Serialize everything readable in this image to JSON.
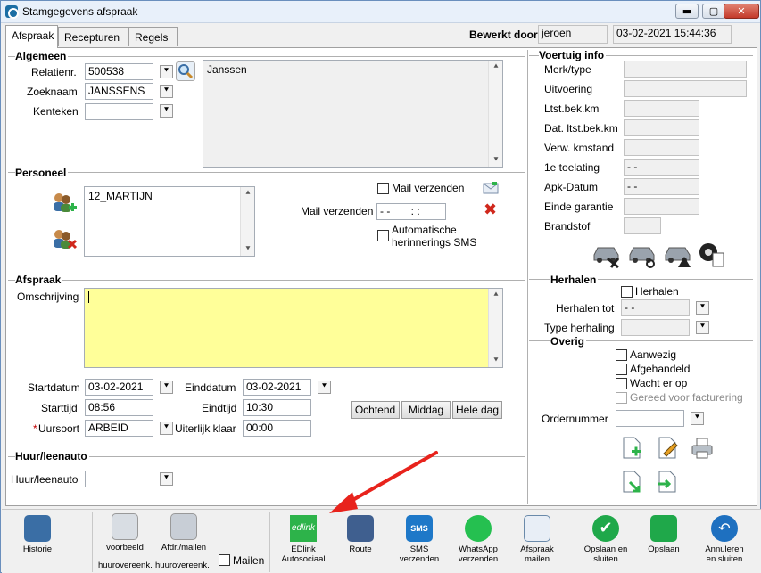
{
  "window": {
    "title": "Stamgegevens afspraak",
    "minimize": "▬",
    "maximize": "▢",
    "close": "✕"
  },
  "tabs": [
    "Afspraak",
    "Recepturen",
    "Regels"
  ],
  "header": {
    "edited_by_label": "Bewerkt door",
    "edited_by": "jeroen",
    "edited_at": "03-02-2021 15:44:36"
  },
  "algemeen": {
    "section": "Algemeen",
    "relatienr_label": "Relatienr.",
    "relatienr": "500538",
    "zoeknaam_label": "Zoeknaam",
    "zoeknaam": "JANSSENS",
    "kenteken_label": "Kenteken",
    "kenteken": "",
    "memo": "Janssen"
  },
  "personeel": {
    "section": "Personeel",
    "employee": "12_MARTIJN",
    "mail_verzenden_check": "Mail verzenden",
    "mail_verzenden_label": "Mail verzenden",
    "mail_datetime": "- -       : :",
    "auto_sms": "Automatische herinnerings SMS"
  },
  "afspraak": {
    "section": "Afspraak",
    "omschrijving_label": "Omschrijving",
    "startdatum_label": "Startdatum",
    "startdatum": "03-02-2021",
    "einddatum_label": "Einddatum",
    "einddatum": "03-02-2021",
    "starttijd_label": "Starttijd",
    "starttijd": "08:56",
    "eindtijd_label": "Eindtijd",
    "eindtijd": "10:30",
    "uursoort_label": "Uursoort",
    "uursoort_required": "*",
    "uursoort": "ARBEID",
    "uiterlijk_label": "Uiterlijk klaar",
    "uiterlijk": "00:00",
    "ochtend": "Ochtend",
    "middag": "Middag",
    "heledag": "Hele dag"
  },
  "huur": {
    "section": "Huur/leenauto",
    "label": "Huur/leenauto",
    "value": ""
  },
  "voertuig": {
    "section": "Voertuig info",
    "fields": [
      {
        "label": "Merk/type",
        "value": ""
      },
      {
        "label": "Uitvoering",
        "value": ""
      },
      {
        "label": "Ltst.bek.km",
        "value": ""
      },
      {
        "label": "Dat. ltst.bek.km",
        "value": ""
      },
      {
        "label": "Verw. kmstand",
        "value": ""
      },
      {
        "label": "1e toelating",
        "value": "- -"
      },
      {
        "label": "Apk-Datum",
        "value": "- -"
      },
      {
        "label": "Einde garantie",
        "value": ""
      },
      {
        "label": "Brandstof",
        "value": ""
      }
    ]
  },
  "herhalen": {
    "section": "Herhalen",
    "check": "Herhalen",
    "tot_label": "Herhalen tot",
    "tot": "- -",
    "type_label": "Type herhaling",
    "type": ""
  },
  "overig": {
    "section": "Overig",
    "aanwezig": "Aanwezig",
    "afgehandeld": "Afgehandeld",
    "wacht": "Wacht er op",
    "gereed": "Gereed voor facturering",
    "ordernummer_label": "Ordernummer",
    "ordernummer": ""
  },
  "toolbar": {
    "historie": "Historie",
    "voorbeeld": "voorbeeld",
    "afdr": "Afdr./mailen",
    "huur1": "huurovereenk.",
    "huur2": "huurovereenk.",
    "mailen": "Mailen",
    "edlink1": "EDlink",
    "edlink2": "Autosociaal",
    "edlink_logo": "edlink",
    "route": "Route",
    "sms1": "SMS",
    "sms2": "verzenden",
    "sms_logo": "SMS",
    "wa1": "WhatsApp",
    "wa2": "verzenden",
    "afspraakmail1": "Afspraak",
    "afspraakmail2": "mailen",
    "opslaansluiten1": "Opslaan en",
    "opslaansluiten2": "sluiten",
    "opslaan": "Opslaan",
    "annuleren1": "Annuleren",
    "annuleren2": "en sluiten"
  },
  "colors": {
    "memo_yellow": "#ffff99",
    "arrow": "#e8231c",
    "edlink_green": "#2db34a"
  }
}
